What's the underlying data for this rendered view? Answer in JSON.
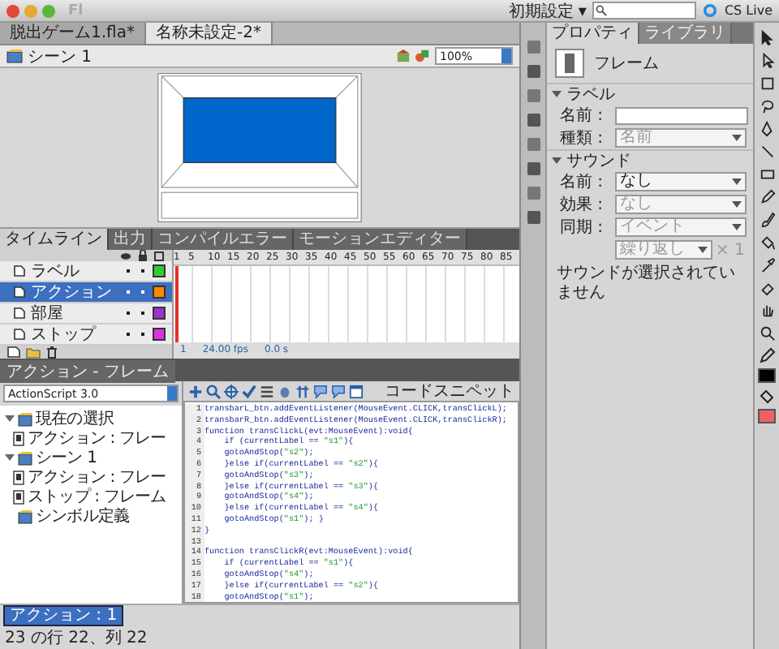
{
  "app": {
    "logo": "Fl",
    "workspace": "初期設定 ▾",
    "cs_live": "CS Live"
  },
  "documents": [
    {
      "title": "脱出ゲーム1.fla*",
      "selected": false
    },
    {
      "title": "名称未設定-2*",
      "selected": true
    }
  ],
  "edit_bar": {
    "scene": "シーン 1",
    "zoom": "100%"
  },
  "timeline": {
    "tabs": [
      {
        "label": "タイムライン",
        "selected": true
      },
      {
        "label": "出力",
        "selected": false
      },
      {
        "label": "コンパイルエラー",
        "selected": false
      },
      {
        "label": "モーションエディター",
        "selected": false
      }
    ],
    "ruler": [
      "1",
      "5",
      "10",
      "15",
      "20",
      "25",
      "30",
      "35",
      "40",
      "45",
      "50",
      "55",
      "60",
      "65",
      "70",
      "75",
      "80",
      "85"
    ],
    "layers": [
      {
        "name": "ラベル",
        "color": "#33cc33",
        "selected": false
      },
      {
        "name": "アクション",
        "color": "#ff8800",
        "selected": true
      },
      {
        "name": "部屋",
        "color": "#9933cc",
        "selected": false
      },
      {
        "name": "ストップ",
        "color": "#dd33dd",
        "selected": false
      }
    ],
    "status": {
      "frame": "1",
      "fps": "24.00 fps",
      "time": "0.0 s"
    }
  },
  "actions": {
    "title": "アクション - フレーム",
    "language": "ActionScript 3.0",
    "snippets": "コードスニペット",
    "tree": [
      {
        "label": "現在の選択",
        "expanded": true,
        "children": [
          {
            "label": "アクション : フレー"
          }
        ]
      },
      {
        "label": "シーン 1",
        "expanded": true,
        "children": [
          {
            "label": "アクション : フレー"
          },
          {
            "label": "ストップ : フレーム"
          }
        ]
      },
      {
        "label": "シンボル定義"
      }
    ],
    "lines": [
      {
        "number": "1",
        "text": "transbarL_btn.addEventListener(MouseEvent.CLICK,transClickL);"
      },
      {
        "number": "2",
        "text": "transbarR_btn.addEventListener(MouseEvent.CLICK,transClickR);"
      },
      {
        "number": "3",
        "text": "function transClickL(evt:MouseEvent):void{"
      },
      {
        "number": "4",
        "text": "    if (currentLabel == \"s1\"){"
      },
      {
        "number": "5",
        "text": "    gotoAndStop(\"s2\");"
      },
      {
        "number": "6",
        "text": "    }else if(currentLabel == \"s2\"){"
      },
      {
        "number": "7",
        "text": "    gotoAndStop(\"s3\");"
      },
      {
        "number": "8",
        "text": "    }else if(currentLabel == \"s3\"){"
      },
      {
        "number": "9",
        "text": "    gotoAndStop(\"s4\");"
      },
      {
        "number": "10",
        "text": "    }else if(currentLabel == \"s4\"){"
      },
      {
        "number": "11",
        "text": "    gotoAndStop(\"s1\"); }"
      },
      {
        "number": "12",
        "text": "}"
      },
      {
        "number": "13"
      },
      {
        "number": "14",
        "text": "function transClickR(evt:MouseEvent):void{"
      },
      {
        "number": "15",
        "text": "    if (currentLabel == \"s1\"){"
      },
      {
        "number": "16",
        "text": "    gotoAndStop(\"s4\");"
      },
      {
        "number": "17",
        "text": "    }else if(currentLabel == \"s2\"){"
      },
      {
        "number": "18",
        "text": "    gotoAndStop(\"s1\");"
      }
    ],
    "script_tab": "アクション : 1",
    "status": "23 の行 22、列 22"
  },
  "properties": {
    "tabs": [
      {
        "label": "プロパティ",
        "selected": true
      },
      {
        "label": "ライブラリ",
        "selected": false
      }
    ],
    "type": "フレーム",
    "sections": [
      {
        "title": "ラベル",
        "expanded": true,
        "rows": [
          {
            "kind": "field",
            "label": "名前 :"
          },
          {
            "kind": "select",
            "label": "種類 :",
            "value": "名前",
            "disabled": true
          }
        ]
      },
      {
        "title": "サウンド",
        "expanded": true,
        "rows": [
          {
            "kind": "select",
            "label": "名前 :",
            "value": "なし",
            "disabled": false
          },
          {
            "kind": "select",
            "label": "効果 :",
            "value": "なし",
            "disabled": true
          },
          {
            "kind": "select",
            "label": "同期 :",
            "value": "イベント",
            "disabled": true
          },
          {
            "kind": "repeat",
            "value": "繰り返し",
            "count": "× 1",
            "disabled": true
          }
        ]
      }
    ],
    "note": "サウンドが選択されていません"
  },
  "tools": {
    "swatches": [
      {
        "kind": "stroke",
        "color": "#000000"
      },
      {
        "kind": "fill",
        "color": "#f06060"
      }
    ]
  }
}
